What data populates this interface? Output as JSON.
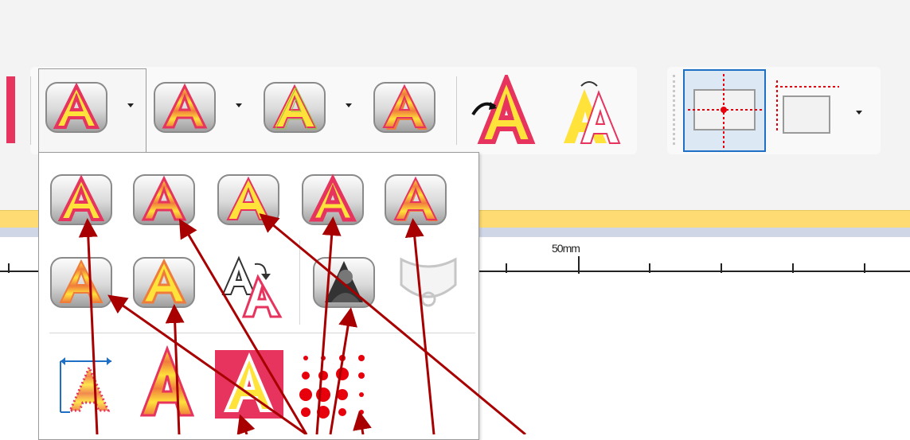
{
  "ruler": {
    "label": "50mm"
  },
  "toolbar": {
    "text_style_1": "text-style-fill-icon",
    "text_style_2": "text-style-striped-icon",
    "text_style_3": "text-style-outline-icon",
    "text_style_4": "text-style-shadow-icon",
    "arc_text": "arc-text-icon",
    "transform_text": "transform-text-icon",
    "position_center": "position-center-icon",
    "position_origin": "position-origin-icon"
  },
  "dropdown": {
    "gallery_rows": [
      [
        "fill",
        "striped",
        "outline",
        "bold-outline",
        "bevel"
      ],
      [
        "hatched",
        "soft-outline",
        "rotate-text",
        "photo-fill",
        "shape-disabled"
      ],
      [
        "kerning",
        "tall-striped",
        "selected-boxed",
        "dot-pattern"
      ]
    ]
  },
  "colors": {
    "accent_red": "#e7345e",
    "ruler_yellow": "#ffdc73",
    "arrow": "#a80000",
    "selection_blue": "#1f6fc4"
  }
}
